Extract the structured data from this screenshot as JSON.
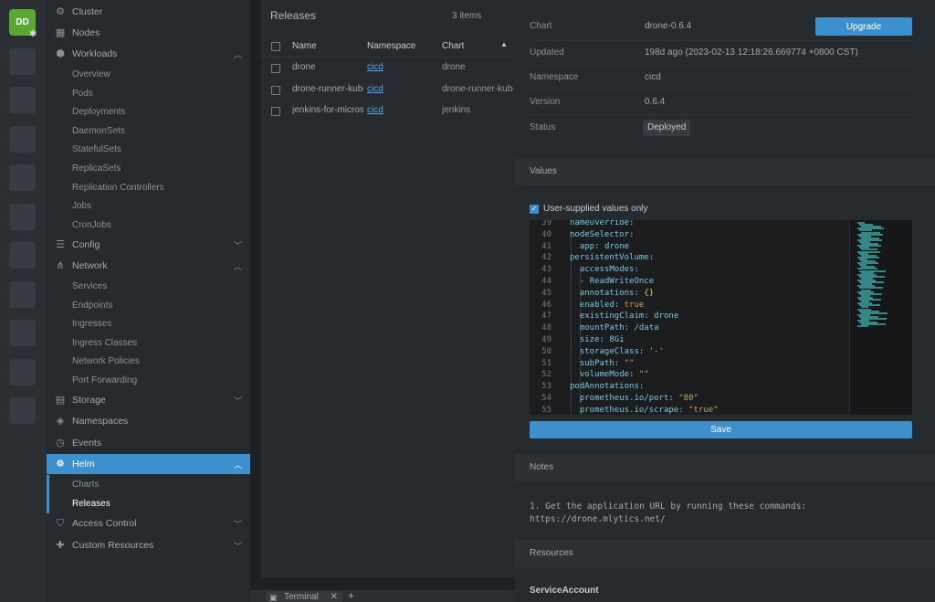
{
  "rail": {
    "avatar_initials": "DD"
  },
  "sidebar": {
    "items": [
      {
        "label": "Cluster",
        "icon": "cluster-icon"
      },
      {
        "label": "Nodes",
        "icon": "nodes-icon"
      },
      {
        "label": "Workloads",
        "icon": "workloads-icon"
      },
      {
        "label": "Config",
        "icon": "config-icon"
      },
      {
        "label": "Network",
        "icon": "network-icon"
      },
      {
        "label": "Storage",
        "icon": "storage-icon"
      },
      {
        "label": "Namespaces",
        "icon": "namespaces-icon"
      },
      {
        "label": "Events",
        "icon": "events-icon"
      },
      {
        "label": "Helm",
        "icon": "helm-icon"
      },
      {
        "label": "Access Control",
        "icon": "shield-icon"
      },
      {
        "label": "Custom Resources",
        "icon": "puzzle-icon"
      }
    ],
    "workloads_sub": [
      "Overview",
      "Pods",
      "Deployments",
      "DaemonSets",
      "StatefulSets",
      "ReplicaSets",
      "Replication Controllers",
      "Jobs",
      "CronJobs"
    ],
    "network_sub": [
      "Services",
      "Endpoints",
      "Ingresses",
      "Ingress Classes",
      "Network Policies",
      "Port Forwarding"
    ],
    "helm_sub": [
      "Charts",
      "Releases"
    ]
  },
  "releases": {
    "title": "Releases",
    "count": "3 items",
    "columns": [
      "Name",
      "Namespace",
      "Chart"
    ],
    "rows": [
      {
        "name": "drone",
        "namespace": "cicd",
        "chart": "drone"
      },
      {
        "name": "drone-runner-kube",
        "namespace": "cicd",
        "chart": "drone-runner-kube"
      },
      {
        "name": "jenkins-for-microservices",
        "namespace": "cicd",
        "chart": "jenkins"
      }
    ]
  },
  "terminal": {
    "tab_label": "Terminal",
    "add": "+"
  },
  "details": {
    "fields": [
      {
        "key": "Chart",
        "value": "drone-0.6.4"
      },
      {
        "key": "Updated",
        "value": "198d ago (2023-02-13 12:18:26.669774 +0800 CST)"
      },
      {
        "key": "Namespace",
        "value": "cicd"
      },
      {
        "key": "Version",
        "value": "0.6.4"
      },
      {
        "key": "Status",
        "value": "Deployed"
      }
    ],
    "upgrade_label": "Upgrade",
    "values_section": "Values",
    "user_supplied_label": "User-supplied values only",
    "save_label": "Save",
    "notes_section": "Notes",
    "notes_text": "1. Get the application URL by running these commands:\nhttps://drone.mlytics.net/",
    "resources_section": "Resources",
    "resources_first": "ServiceAccount"
  },
  "editor": {
    "lines": [
      {
        "n": "39",
        "indent": 0,
        "parts": [
          [
            "key",
            "nameOverride"
          ],
          [
            "txt",
            ":"
          ]
        ]
      },
      {
        "n": "40",
        "indent": 0,
        "parts": [
          [
            "key",
            "nodeSelector"
          ],
          [
            "txt",
            ":"
          ]
        ]
      },
      {
        "n": "41",
        "indent": 1,
        "parts": [
          [
            "key",
            "app"
          ],
          [
            "txt",
            ": "
          ],
          [
            "txt",
            "drone"
          ]
        ]
      },
      {
        "n": "42",
        "indent": 0,
        "parts": [
          [
            "key",
            "persistentVolume"
          ],
          [
            "txt",
            ":"
          ]
        ]
      },
      {
        "n": "43",
        "indent": 1,
        "parts": [
          [
            "key",
            "accessModes"
          ],
          [
            "txt",
            ":"
          ]
        ]
      },
      {
        "n": "44",
        "indent": 1,
        "parts": [
          [
            "dash",
            "- "
          ],
          [
            "txt",
            "ReadWriteOnce"
          ]
        ]
      },
      {
        "n": "45",
        "indent": 1,
        "parts": [
          [
            "key",
            "annotations"
          ],
          [
            "txt",
            ": "
          ],
          [
            "brace",
            "{}"
          ]
        ]
      },
      {
        "n": "46",
        "indent": 1,
        "parts": [
          [
            "key",
            "enabled"
          ],
          [
            "txt",
            ": "
          ],
          [
            "str",
            "true"
          ]
        ]
      },
      {
        "n": "47",
        "indent": 1,
        "parts": [
          [
            "key",
            "existingClaim"
          ],
          [
            "txt",
            ": "
          ],
          [
            "txt",
            "drone"
          ]
        ]
      },
      {
        "n": "48",
        "indent": 1,
        "parts": [
          [
            "key",
            "mountPath"
          ],
          [
            "txt",
            ": "
          ],
          [
            "txt",
            "/data"
          ]
        ]
      },
      {
        "n": "49",
        "indent": 1,
        "parts": [
          [
            "key",
            "size"
          ],
          [
            "txt",
            ": "
          ],
          [
            "txt",
            "8Gi"
          ]
        ]
      },
      {
        "n": "50",
        "indent": 1,
        "parts": [
          [
            "key",
            "storageClass"
          ],
          [
            "txt",
            ": "
          ],
          [
            "str",
            "'-'"
          ]
        ]
      },
      {
        "n": "51",
        "indent": 1,
        "parts": [
          [
            "key",
            "subPath"
          ],
          [
            "txt",
            ": "
          ],
          [
            "str",
            "\"\""
          ]
        ]
      },
      {
        "n": "52",
        "indent": 1,
        "parts": [
          [
            "key",
            "volumeMode"
          ],
          [
            "txt",
            ": "
          ],
          [
            "str",
            "\"\""
          ]
        ]
      },
      {
        "n": "53",
        "indent": 0,
        "parts": [
          [
            "key",
            "podAnnotations"
          ],
          [
            "txt",
            ":"
          ]
        ]
      },
      {
        "n": "54",
        "indent": 1,
        "parts": [
          [
            "key",
            "prometheus.io/port"
          ],
          [
            "txt",
            ": "
          ],
          [
            "str",
            "\"80\""
          ]
        ]
      },
      {
        "n": "55",
        "indent": 1,
        "parts": [
          [
            "key",
            "prometheus.io/scrape"
          ],
          [
            "txt",
            ": "
          ],
          [
            "str",
            "\"true\""
          ]
        ]
      }
    ]
  },
  "colors": {
    "accent": "#3d90ce",
    "avatar": "#5aa832",
    "sidebar_bg": "#262b2f"
  }
}
